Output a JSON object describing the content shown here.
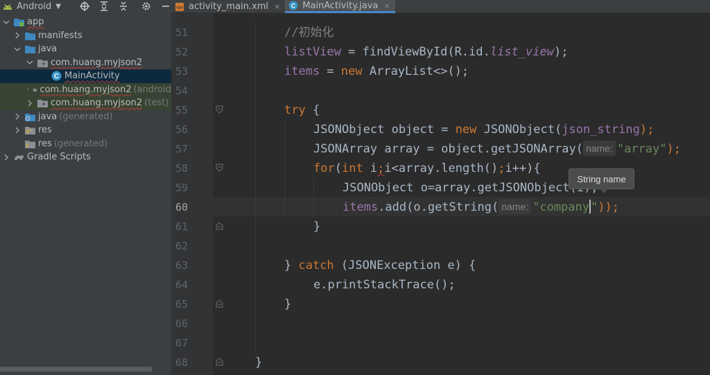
{
  "project_panel": {
    "view_selector": "Android",
    "tree": [
      {
        "label": "app",
        "suffix": ""
      },
      {
        "label": "manifests",
        "suffix": ""
      },
      {
        "label": "java",
        "suffix": ""
      },
      {
        "label": "com.huang.myjson2",
        "suffix": ""
      },
      {
        "label": "MainActivity",
        "suffix": ""
      },
      {
        "label": "com.huang.myjson2",
        "suffix": "(android"
      },
      {
        "label": "com.huang.myjson2",
        "suffix": "(test)"
      },
      {
        "label": "java",
        "suffix": "(generated)"
      },
      {
        "label": "res",
        "suffix": ""
      },
      {
        "label": "res",
        "suffix": "(generated)"
      },
      {
        "label": "Gradle Scripts",
        "suffix": ""
      }
    ]
  },
  "tabs": [
    {
      "label": "activity_main.xml",
      "close": "×"
    },
    {
      "label": "MainActivity.java",
      "close": "×"
    }
  ],
  "editor": {
    "line_numbers": [
      "51",
      "52",
      "53",
      "54",
      "55",
      "56",
      "57",
      "58",
      "59",
      "60",
      "61",
      "62",
      "63",
      "64",
      "65",
      "66",
      "67",
      "68"
    ],
    "current_line": "60",
    "code": {
      "l51": {
        "comment": "//初始化"
      },
      "l52": {
        "field": "listView",
        "eq": " = findViewById(R.id.",
        "id": "list_view",
        "end": ");"
      },
      "l53": {
        "field": "items",
        "eq": " = ",
        "kw": "new",
        "rest": " ArrayList<>();"
      },
      "l55": {
        "kw": "try",
        "rest": " {"
      },
      "l56": {
        "pre": "JSONObject object = ",
        "kw": "new",
        "mid": " JSONObject(",
        "field": "json_string",
        "end": ");"
      },
      "l57": {
        "pre": "JSONArray array = object.getJSONArray(",
        "hint": "name:",
        "str": "\"array\"",
        "end": ");"
      },
      "l58": {
        "kw1": "for",
        "p1": "(",
        "kw2": "int",
        "p2": " i",
        "semi1": ";",
        "p3": "i<array.length()",
        "semi2": ";",
        "p4": "i++){"
      },
      "l59": {
        "text": "JSONObject o=array.getJSONObject(i);"
      },
      "l60": {
        "field": "items",
        "pre": ".add(o.getString(",
        "hint": "name:",
        "str": "\"company",
        "str_end": "\"",
        "end": "));"
      },
      "l61": {
        "text": "}"
      },
      "l63": {
        "pre": "} ",
        "kw": "catch",
        "rest": " (JSONException e) {"
      },
      "l64": {
        "text": "e.printStackTrace();"
      },
      "l65": {
        "text": "}"
      },
      "l68": {
        "text": "}"
      }
    },
    "tooltip": "String name"
  }
}
